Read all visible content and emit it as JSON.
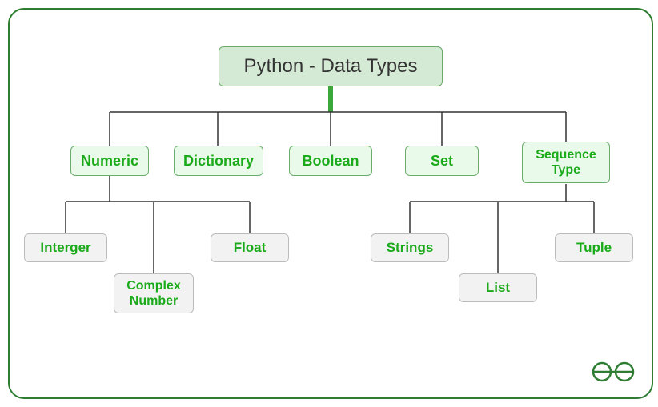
{
  "root": {
    "label": "Python - Data Types"
  },
  "categories": {
    "numeric": "Numeric",
    "dictionary": "Dictionary",
    "boolean": "Boolean",
    "set": "Set",
    "sequence": "Sequence Type"
  },
  "numeric_children": {
    "integer": "Interger",
    "complex": "Complex Number",
    "float": "Float"
  },
  "sequence_children": {
    "strings": "Strings",
    "list": "List",
    "tuple": "Tuple"
  }
}
